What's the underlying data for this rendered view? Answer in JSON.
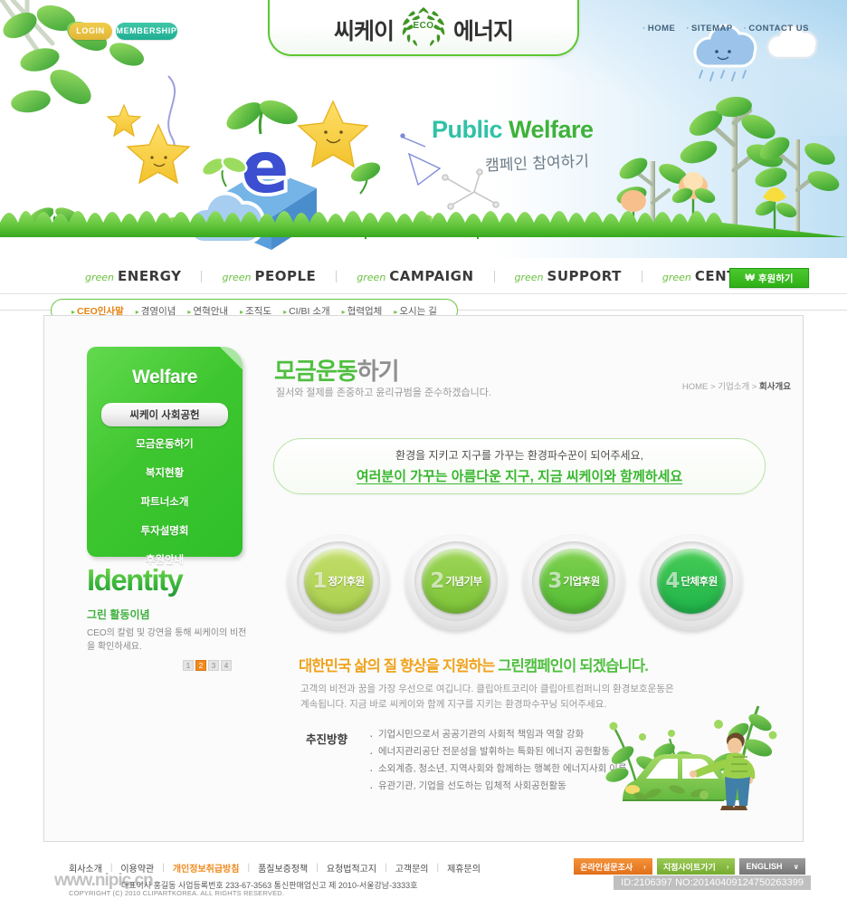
{
  "header": {
    "login_label": "LOGIN",
    "membership_label": "MEMBERSHIP",
    "top_links": [
      "HOME",
      "SITEMAP",
      "CONTACT US"
    ],
    "logo_left": "씨케이",
    "logo_right": "에너지",
    "logo_emblem_text": "ECO",
    "hero_title_1": "Public ",
    "hero_title_2": "Welfare",
    "hero_sub": "캠페인 참여하기"
  },
  "gnb": [
    {
      "green": "green",
      "name": "ENERGY"
    },
    {
      "green": "green",
      "name": "PEOPLE"
    },
    {
      "green": "green",
      "name": "CAMPAIGN"
    },
    {
      "green": "green",
      "name": "SUPPORT"
    },
    {
      "green": "green",
      "name": "CENTER"
    }
  ],
  "donate_button": {
    "label": "후원하기",
    "icon": "won-icon",
    "glyph": "₩"
  },
  "subnav": [
    {
      "label": "CEO인사말",
      "active": true
    },
    {
      "label": "경영이념",
      "active": false
    },
    {
      "label": "연혁안내",
      "active": false
    },
    {
      "label": "조직도",
      "active": false
    },
    {
      "label": "CI/BI 소개",
      "active": false
    },
    {
      "label": "협력업체",
      "active": false
    },
    {
      "label": "오시는 길",
      "active": false
    }
  ],
  "sidebar": {
    "title": "Welfare",
    "items": [
      {
        "label": "씨케이 사회공헌",
        "active": true
      },
      {
        "label": "모금운동하기",
        "active": false
      },
      {
        "label": "복지현황",
        "active": false
      },
      {
        "label": "파트너소개",
        "active": false
      },
      {
        "label": "투자설명회",
        "active": false
      },
      {
        "label": "후원안내",
        "active": false
      }
    ]
  },
  "identity": {
    "logo": "Identity",
    "subtitle": "그린 활동이념",
    "description": "CEO의 칼럼 및 강연을 통해 씨케이의 비전을 확인하세요.",
    "pager": [
      "1",
      "2",
      "3",
      "4"
    ],
    "pager_active": "2"
  },
  "main": {
    "title_green": "모금운동",
    "title_gray": "하기",
    "subtitle": "질서와 절제를 존중하고 윤리규범을 준수하겠습니다.",
    "breadcrumb": {
      "home": "HOME",
      "sep": ">",
      "level1": "기업소개",
      "level2": "회사개요"
    },
    "notice_line1": "환경을 지키고 지구를 가꾸는 환경파수꾼이 되어주세요,",
    "notice_line2": "여러분이 가꾸는 아름다운 지구, 지금 씨케이와 함께하세요",
    "circles": [
      {
        "num": "1",
        "label": "정기후원",
        "color": "#c3de6a",
        "color2": "#a9cf4e"
      },
      {
        "num": "2",
        "label": "기념기부",
        "color": "#9ed558",
        "color2": "#7cc437"
      },
      {
        "num": "3",
        "label": "기업후원",
        "color": "#7fd14f",
        "color2": "#52bb33"
      },
      {
        "num": "4",
        "label": "단체후원",
        "color": "#48cc55",
        "color2": "#1eb34a"
      }
    ],
    "campaign_title_orange": "대한민국 삶의 질 향상을 지원하는 ",
    "campaign_title_green": "그린캠페인이 되겠습니다.",
    "campaign_body": "고객의 비전과 꿈을 가장 우선으로 여깁니다. 클립아트코리아 클립아트컴퍼니의 환경보호운동은 계속됩니다. 지금 바로 씨케이와 함께 지구를 지키는 환경파수꾸닝 되어주세요.",
    "direction_label": "추진방향",
    "direction_items": [
      "기업시민으로서 공공기관의 사회적 책임과 역할 강화",
      "에너지관리공단 전문성을 발휘하는 특화된 에너지 공헌활동",
      "소외계층, 청소년, 지역사회와 함께하는 행복한 에너지사회 이룩",
      "유관기관, 기업을 선도하는 입체적 사회공헌활동"
    ]
  },
  "footer": {
    "links": [
      {
        "label": "회사소개",
        "highlight": false
      },
      {
        "label": "이용약관",
        "highlight": false
      },
      {
        "label": "개인정보취급방침",
        "highlight": true
      },
      {
        "label": "품질보증정책",
        "highlight": false
      },
      {
        "label": "요청법적고지",
        "highlight": false
      },
      {
        "label": "고객문의",
        "highlight": false
      },
      {
        "label": "제휴문의",
        "highlight": false
      }
    ],
    "watermark": "www.nipic.cn",
    "meta": "대표이사 홍길동 사업등록번호 233-67-3563 통신판매업신고 제 2010-서울강남-3333호",
    "copyright": "COPYRIGHT (C) 2010 CLIPARTKOREA. ALL RIGHTS RESERVED.",
    "buttons": [
      {
        "label": "온라인설문조사",
        "arrow": "›",
        "style": "orange"
      },
      {
        "label": "지점사이트가기",
        "arrow": "›",
        "style": "green"
      },
      {
        "label": "ENGLISH",
        "arrow": "∨",
        "style": "gray"
      }
    ],
    "id_overlay": "ID:2106397 NO:20140409124750263399"
  },
  "colors": {
    "brand_green": "#4fbf3f",
    "nav_green": "#6cc043",
    "accent_orange": "#f08a1d",
    "teal": "#2fc2a6",
    "sky_blue": "#bfdff4"
  }
}
